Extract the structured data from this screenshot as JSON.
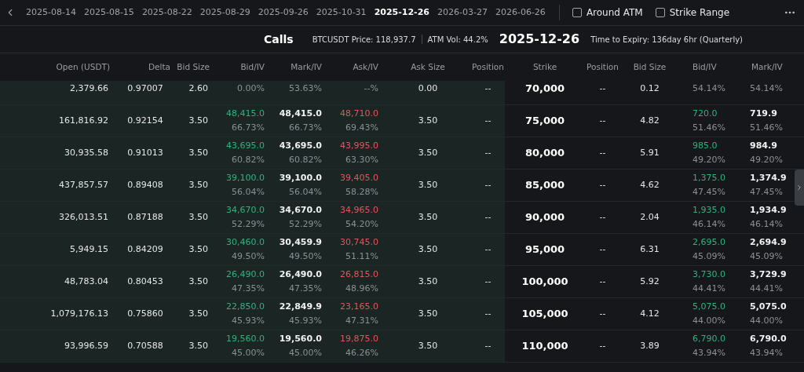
{
  "expiry_tabs": [
    {
      "label": "2025-08-14",
      "selected": false
    },
    {
      "label": "2025-08-15",
      "selected": false
    },
    {
      "label": "2025-08-22",
      "selected": false
    },
    {
      "label": "2025-08-29",
      "selected": false
    },
    {
      "label": "2025-09-26",
      "selected": false
    },
    {
      "label": "2025-10-31",
      "selected": false
    },
    {
      "label": "2025-12-26",
      "selected": true
    },
    {
      "label": "2026-03-27",
      "selected": false
    },
    {
      "label": "2026-06-26",
      "selected": false
    }
  ],
  "filters": [
    {
      "label": "Around ATM",
      "checked": false
    },
    {
      "label": "Strike Range",
      "checked": false
    }
  ],
  "summary": {
    "side": "Calls",
    "price": "BTCUSDT Price: 118,937.7",
    "atm_vol": "ATM Vol: 44.2%",
    "expiry": "2025-12-26",
    "time_to_expiry": "Time to Expiry: 136day 6hr (Quarterly)"
  },
  "columns": {
    "calls": [
      "Open (USDT)",
      "Delta",
      "Bid Size",
      "Bid/IV",
      "Mark/IV",
      "Ask/IV",
      "Ask Size",
      "Position"
    ],
    "strike": "Strike",
    "puts": [
      "Position",
      "Bid Size",
      "Bid/IV",
      "Mark/IV"
    ]
  },
  "rows": [
    {
      "open": "2,379.66",
      "delta": "0.97007",
      "bid_size": "2.60",
      "bid": {
        "iv": "0.00%"
      },
      "mark": {
        "iv": "53.63%"
      },
      "ask": {
        "iv": "--%"
      },
      "ask_size": "0.00",
      "position": "--",
      "strike": "70,000",
      "put_position": "--",
      "put_bid_size": "0.12",
      "put_bid": {
        "iv": "54.14%"
      },
      "put_mark": {
        "iv": "54.14%"
      }
    },
    {
      "open": "161,816.92",
      "delta": "0.92154",
      "bid_size": "3.50",
      "bid": {
        "price": "48,415.0",
        "iv": "66.73%"
      },
      "mark": {
        "price": "48,415.0",
        "iv": "66.73%"
      },
      "ask": {
        "price": "48,710.0",
        "iv": "69.43%"
      },
      "ask_size": "3.50",
      "position": "--",
      "strike": "75,000",
      "put_position": "--",
      "put_bid_size": "4.82",
      "put_bid": {
        "price": "720.0",
        "iv": "51.46%"
      },
      "put_mark": {
        "price": "719.9",
        "iv": "51.46%"
      }
    },
    {
      "open": "30,935.58",
      "delta": "0.91013",
      "bid_size": "3.50",
      "bid": {
        "price": "43,695.0",
        "iv": "60.82%"
      },
      "mark": {
        "price": "43,695.0",
        "iv": "60.82%"
      },
      "ask": {
        "price": "43,995.0",
        "iv": "63.30%"
      },
      "ask_size": "3.50",
      "position": "--",
      "strike": "80,000",
      "put_position": "--",
      "put_bid_size": "5.91",
      "put_bid": {
        "price": "985.0",
        "iv": "49.20%"
      },
      "put_mark": {
        "price": "984.9",
        "iv": "49.20%"
      }
    },
    {
      "open": "437,857.57",
      "delta": "0.89408",
      "bid_size": "3.50",
      "bid": {
        "price": "39,100.0",
        "iv": "56.04%"
      },
      "mark": {
        "price": "39,100.0",
        "iv": "56.04%"
      },
      "ask": {
        "price": "39,405.0",
        "iv": "58.28%"
      },
      "ask_size": "3.50",
      "position": "--",
      "strike": "85,000",
      "put_position": "--",
      "put_bid_size": "4.62",
      "put_bid": {
        "price": "1,375.0",
        "iv": "47.45%"
      },
      "put_mark": {
        "price": "1,374.9",
        "iv": "47.45%"
      }
    },
    {
      "open": "326,013.51",
      "delta": "0.87188",
      "bid_size": "3.50",
      "bid": {
        "price": "34,670.0",
        "iv": "52.29%"
      },
      "mark": {
        "price": "34,670.0",
        "iv": "52.29%"
      },
      "ask": {
        "price": "34,965.0",
        "iv": "54.20%"
      },
      "ask_size": "3.50",
      "position": "--",
      "strike": "90,000",
      "put_position": "--",
      "put_bid_size": "2.04",
      "put_bid": {
        "price": "1,935.0",
        "iv": "46.14%"
      },
      "put_mark": {
        "price": "1,934.9",
        "iv": "46.14%"
      }
    },
    {
      "open": "5,949.15",
      "delta": "0.84209",
      "bid_size": "3.50",
      "bid": {
        "price": "30,460.0",
        "iv": "49.50%"
      },
      "mark": {
        "price": "30,459.9",
        "iv": "49.50%"
      },
      "ask": {
        "price": "30,745.0",
        "iv": "51.11%"
      },
      "ask_size": "3.50",
      "position": "--",
      "strike": "95,000",
      "put_position": "--",
      "put_bid_size": "6.31",
      "put_bid": {
        "price": "2,695.0",
        "iv": "45.09%"
      },
      "put_mark": {
        "price": "2,694.9",
        "iv": "45.09%"
      }
    },
    {
      "open": "48,783.04",
      "delta": "0.80453",
      "bid_size": "3.50",
      "bid": {
        "price": "26,490.0",
        "iv": "47.35%"
      },
      "mark": {
        "price": "26,490.0",
        "iv": "47.35%"
      },
      "ask": {
        "price": "26,815.0",
        "iv": "48.96%"
      },
      "ask_size": "3.50",
      "position": "--",
      "strike": "100,000",
      "put_position": "--",
      "put_bid_size": "5.92",
      "put_bid": {
        "price": "3,730.0",
        "iv": "44.41%"
      },
      "put_mark": {
        "price": "3,729.9",
        "iv": "44.41%"
      }
    },
    {
      "open": "1,079,176.13",
      "delta": "0.75860",
      "bid_size": "3.50",
      "bid": {
        "price": "22,850.0",
        "iv": "45.93%"
      },
      "mark": {
        "price": "22,849.9",
        "iv": "45.93%"
      },
      "ask": {
        "price": "23,165.0",
        "iv": "47.31%"
      },
      "ask_size": "3.50",
      "position": "--",
      "strike": "105,000",
      "put_position": "--",
      "put_bid_size": "4.12",
      "put_bid": {
        "price": "5,075.0",
        "iv": "44.00%"
      },
      "put_mark": {
        "price": "5,075.0",
        "iv": "44.00%"
      }
    },
    {
      "open": "93,996.59",
      "delta": "0.70588",
      "bid_size": "3.50",
      "bid": {
        "price": "19,560.0",
        "iv": "45.00%"
      },
      "mark": {
        "price": "19,560.0",
        "iv": "45.00%"
      },
      "ask": {
        "price": "19,875.0",
        "iv": "46.26%"
      },
      "ask_size": "3.50",
      "position": "--",
      "strike": "110,000",
      "put_position": "--",
      "put_bid_size": "3.89",
      "put_bid": {
        "price": "6,790.0",
        "iv": "43.94%"
      },
      "put_mark": {
        "price": "6,790.0",
        "iv": "43.94%"
      }
    }
  ]
}
